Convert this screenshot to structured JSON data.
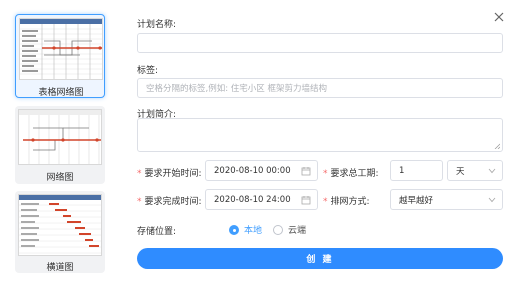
{
  "templates": [
    {
      "label": "表格网络图",
      "selected": true
    },
    {
      "label": "网络图",
      "selected": false
    },
    {
      "label": "横道图",
      "selected": false
    }
  ],
  "form": {
    "plan_name_label": "计划名称:",
    "plan_name_value": "",
    "tags_label": "标签:",
    "tags_placeholder": "空格分隔的标签,例如: 住宅小区 框架剪力墙结构",
    "intro_label": "计划简介:",
    "start_label": "要求开始时间:",
    "start_value": "2020-08-10 00:00",
    "duration_label": "要求总工期:",
    "duration_value": "1",
    "duration_unit": "天",
    "finish_label": "要求完成时间:",
    "finish_value": "2020-08-10 24:00",
    "schedule_label": "排网方式:",
    "schedule_value": "越早越好",
    "storage_label": "存储位置:",
    "storage_options": [
      "本地",
      "云端"
    ],
    "storage_selected": "本地",
    "submit_label": "创 建"
  },
  "colors": {
    "accent": "#409eff",
    "button": "#2f8cff",
    "required": "#f56c6c",
    "gantt_bar": "#d2452b"
  },
  "icons": [
    "close-icon",
    "calendar-icon",
    "chevron-down-icon",
    "resize-grip-icon"
  ]
}
